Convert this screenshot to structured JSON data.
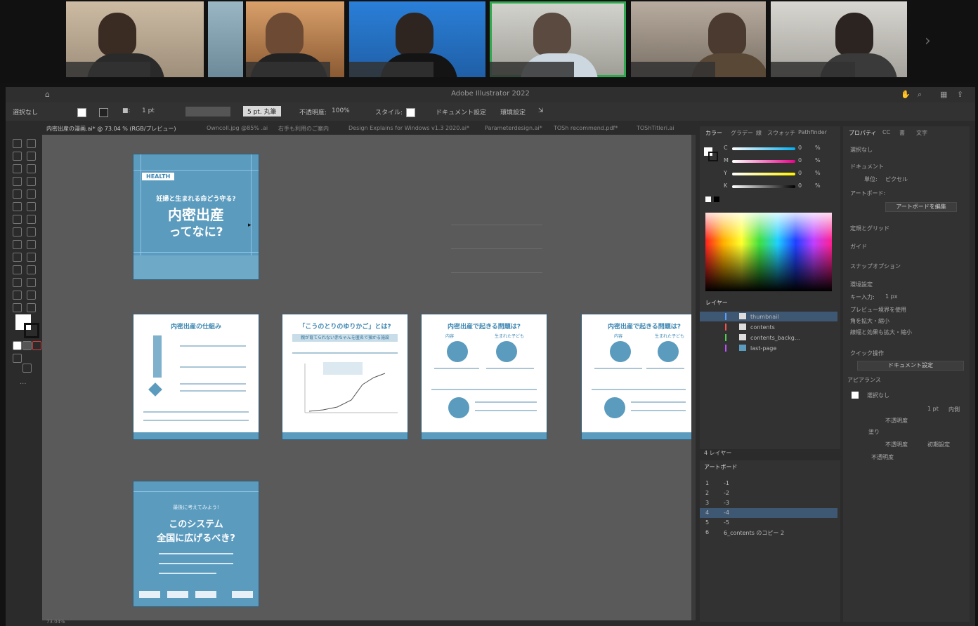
{
  "window": {
    "title": "Adobe Illustrator 2022"
  },
  "control_bar": {
    "selection_label": "選択なし",
    "stroke_weight": "1 pt",
    "brush_label": "5 pt. 丸筆",
    "opacity_label": "不透明度:",
    "opacity_value": "100%",
    "style_label": "スタイル:",
    "document_setup": "ドキュメント設定",
    "preferences": "環境設定"
  },
  "document_tabs": [
    "内密出産の漫画.ai* @ 73.04 % (RGB/プレビュー)",
    "Owncoll.jpg @85% .ai",
    "右手も利用のご案内",
    "Design Explains for Windows v1.3 2020.ai*",
    "Parameterdesign.ai*",
    "TOSh recommend.pdf*",
    "TOShTitleri.ai"
  ],
  "artboards": {
    "cover": {
      "tag": "HEALTH",
      "subtitle": "妊婦と生まれる命どう守る?",
      "title1": "内密出産",
      "title2": "ってなに?"
    },
    "mechanism": {
      "title": "内密出産の仕組み"
    },
    "cradle": {
      "title": "「こうのとりのゆりかご」とは?",
      "banner": "親が育てられない赤ちゃんを匿名で預かる施設"
    },
    "problems": {
      "title": "内密出産で起きる問題は?",
      "col1": "内容",
      "col2": "生まれた子ども"
    },
    "problems_copy": {
      "title": "内密出産で起きる問題は?",
      "col1": "内容",
      "col2": "生まれた子ども"
    },
    "system": {
      "lead": "最後に考えてみよう!",
      "title1": "このシステム",
      "title2": "全国に広げるべき?"
    }
  },
  "color_panel": {
    "tabs": [
      "カラー",
      "グラデー",
      "線",
      "スウォッチ",
      "Pathfinder"
    ],
    "channels": [
      {
        "label": "C",
        "value": "0"
      },
      {
        "label": "M",
        "value": "0"
      },
      {
        "label": "Y",
        "value": "0"
      },
      {
        "label": "K",
        "value": "0"
      }
    ],
    "percent": "%"
  },
  "layers_panel": {
    "tab": "レイヤー",
    "layers": [
      {
        "name": "thumbnail",
        "color": "#5aa0ff"
      },
      {
        "name": "contents",
        "color": "#ff5050"
      },
      {
        "name": "contents_backg...",
        "color": "#50d050"
      },
      {
        "name": "last-page",
        "color": "#c050ff"
      }
    ],
    "count_label": "4 レイヤー"
  },
  "artboards_panel": {
    "tab": "アートボード",
    "rows": [
      {
        "num": "1",
        "name": "-1"
      },
      {
        "num": "2",
        "name": "-2"
      },
      {
        "num": "3",
        "name": "-3"
      },
      {
        "num": "4",
        "name": "-4"
      },
      {
        "num": "5",
        "name": "-5"
      },
      {
        "num": "6",
        "name": "6_contents のコピー 2"
      }
    ]
  },
  "properties_panel": {
    "tabs": [
      "プロパティ",
      "CC",
      "書",
      "文字"
    ],
    "no_selection": "選択なし",
    "document": "ドキュメント",
    "unit_label": "単位:",
    "unit_value": "ピクセル",
    "artboard_label": "アートボード:",
    "edit_artboard": "アートボードを編集",
    "rulers_grid": "定規とグリッド",
    "guides": "ガイド",
    "snap_options": "スナップオプション",
    "preferences": "環境設定",
    "key_increment_label": "キー入力:",
    "key_increment_value": "1 px",
    "options": [
      "プレビュー境界を使用",
      "角を拡大・縮小",
      "線幅と効果も拡大・縮小"
    ],
    "quick_actions": "クイック操作",
    "document_setup_btn": "ドキュメント設定",
    "appearance": "アピアランス",
    "appearance_sel": "選択なし",
    "stroke_weight": "1 pt",
    "stroke_pos": "内側",
    "fill_label": "塗り",
    "opacity_btn": "不透明度",
    "opacity_btn2": "不透明度",
    "opacity_btn3": "不透明度",
    "default_label": "初期設定"
  },
  "status_bar": {
    "zoom": "73.04%"
  }
}
